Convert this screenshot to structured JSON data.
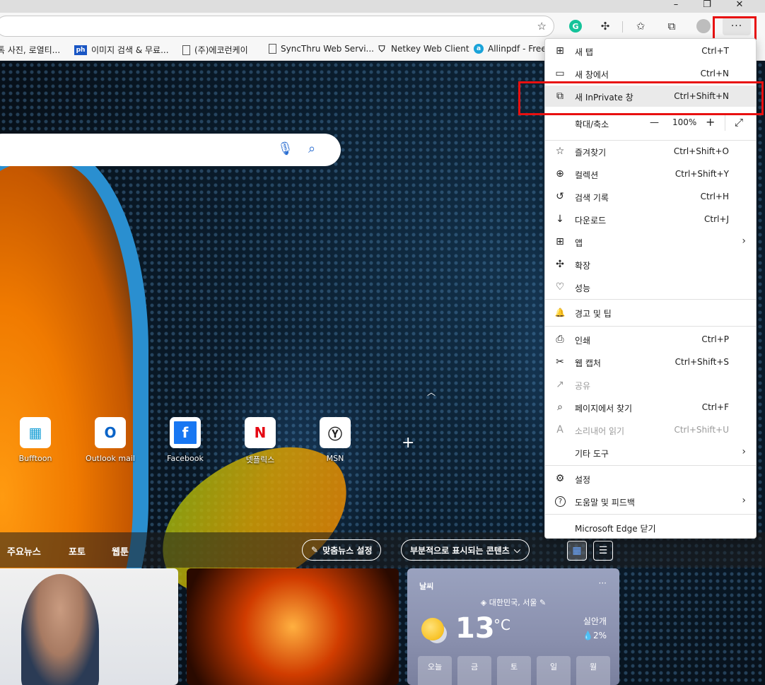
{
  "window": {
    "minimize": "–",
    "restore": "❐",
    "close": "✕"
  },
  "toolbar": {
    "grammarly_letter": "G",
    "more_label": "···"
  },
  "favorites": [
    {
      "label": "톡 사진, 로열티...",
      "icon": "none"
    },
    {
      "label": "이미지 검색 & 무료...",
      "icon": "ph"
    },
    {
      "label": "(주)에코런케이",
      "icon": "page-icon"
    },
    {
      "label": "SyncThru Web Servi...",
      "icon": "page-icon"
    },
    {
      "label": "Netkey Web Client",
      "icon": "shield-icon"
    },
    {
      "label": "Allinpdf - Free",
      "icon": "allinpdf-icon"
    }
  ],
  "quick_links": [
    {
      "label": "Bufftoon",
      "glyph": "▦",
      "color": "#19a0d6"
    },
    {
      "label": "Outlook mail",
      "glyph": "O",
      "color": "#0a64c8"
    },
    {
      "label": "Facebook",
      "glyph": "f",
      "color": "#1877f2"
    },
    {
      "label": "넷플릭스",
      "glyph": "N",
      "color": "#e50914"
    },
    {
      "label": "MSN",
      "glyph": "Ⓨ",
      "color": "#222222"
    }
  ],
  "news_bar": {
    "tabs": [
      "주요뉴스",
      "포토",
      "웹툰"
    ],
    "personalize": "맞춤뉴스 설정",
    "content_view": "부분적으로 표시되는 콘텐츠"
  },
  "weather": {
    "title": "날씨",
    "location": "대한민국, 서울",
    "temperature": "13",
    "unit": "°C",
    "condition": "실안개",
    "precip": "2%",
    "days": [
      "오늘",
      "금",
      "토",
      "일",
      "월"
    ]
  },
  "menu": {
    "items": [
      {
        "label": "새 탭",
        "shortcut": "Ctrl+T",
        "icon": "new-tab-icon",
        "glyph": "⊞"
      },
      {
        "label": "새 창에서",
        "shortcut": "Ctrl+N",
        "icon": "new-window-icon",
        "glyph": "▭"
      },
      {
        "label": "새 InPrivate 창",
        "shortcut": "Ctrl+Shift+N",
        "icon": "inprivate-icon",
        "glyph": "⧉"
      },
      {
        "label": "확대/축소",
        "zoom": "100%",
        "minus": "—",
        "plus": "+",
        "fullscreen": "⤢"
      },
      {
        "label": "즐겨찾기",
        "shortcut": "Ctrl+Shift+O",
        "icon": "favorites-icon",
        "glyph": "☆"
      },
      {
        "label": "컬렉션",
        "shortcut": "Ctrl+Shift+Y",
        "icon": "collections-icon",
        "glyph": "⊕"
      },
      {
        "label": "검색 기록",
        "shortcut": "Ctrl+H",
        "icon": "history-icon",
        "glyph": "↺"
      },
      {
        "label": "다운로드",
        "shortcut": "Ctrl+J",
        "icon": "download-icon",
        "glyph": "↓"
      },
      {
        "label": "앱",
        "shortcut": "",
        "icon": "apps-icon",
        "glyph": "⊞",
        "arrow": "›"
      },
      {
        "label": "확장",
        "shortcut": "",
        "icon": "extensions-icon",
        "glyph": "✣"
      },
      {
        "label": "성능",
        "shortcut": "",
        "icon": "performance-icon",
        "glyph": "♡"
      },
      {
        "label": "경고 및 팁",
        "shortcut": "",
        "icon": "bell-icon",
        "glyph": "🔔"
      },
      {
        "label": "인쇄",
        "shortcut": "Ctrl+P",
        "icon": "print-icon",
        "glyph": "⎙"
      },
      {
        "label": "웹 캡처",
        "shortcut": "Ctrl+Shift+S",
        "icon": "web-capture-icon",
        "glyph": "✂"
      },
      {
        "label": "공유",
        "shortcut": "",
        "icon": "share-icon",
        "glyph": "↗"
      },
      {
        "label": "페이지에서 찾기",
        "shortcut": "Ctrl+F",
        "icon": "find-icon",
        "glyph": "⌕"
      },
      {
        "label": "소리내어 읽기",
        "shortcut": "Ctrl+Shift+U",
        "icon": "read-aloud-icon",
        "glyph": "A"
      },
      {
        "label": "기타 도구",
        "shortcut": "",
        "icon": "",
        "glyph": "",
        "arrow": "›"
      },
      {
        "label": "설정",
        "shortcut": "",
        "icon": "settings-icon",
        "glyph": "⚙"
      },
      {
        "label": "도움말 및 피드백",
        "shortcut": "",
        "icon": "help-icon",
        "glyph": "?",
        "arrow": "›"
      },
      {
        "label": "Microsoft Edge 닫기",
        "shortcut": "",
        "icon": "",
        "glyph": ""
      }
    ]
  },
  "colors": {
    "highlight": "#e81010",
    "accent": "#2b6ed1"
  }
}
